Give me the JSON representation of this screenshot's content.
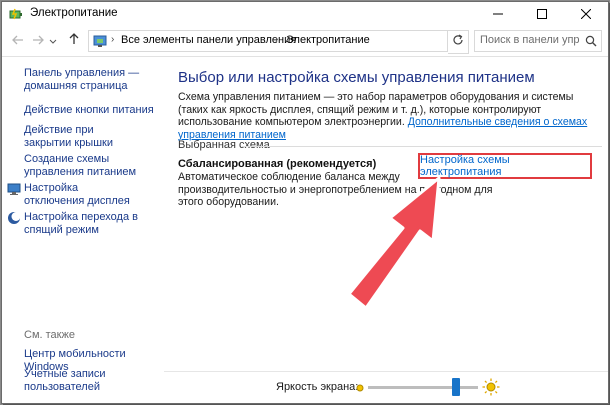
{
  "window": {
    "title": "Электропитание",
    "icons": {
      "app": "power-battery-icon",
      "minimize": "minimize-icon",
      "maximize": "maximize-icon",
      "close": "close-icon"
    }
  },
  "address_bar": {
    "crumbs": [
      "Все элементы панели управления",
      "Электропитание"
    ],
    "search_placeholder": "Поиск в панели управления",
    "icons": {
      "back": "arrow-left-icon",
      "forward": "arrow-right-icon",
      "recent": "chevron-down-icon",
      "up": "arrow-up-icon",
      "location": "control-panel-icon",
      "refresh": "refresh-icon",
      "search": "search-icon"
    }
  },
  "sidebar": {
    "home_link": "Панель управления — домашняя страница",
    "links": [
      {
        "label": "Действие кнопки питания"
      },
      {
        "label": "Действие при закрытии крышки"
      },
      {
        "label": "Создание схемы управления питанием"
      },
      {
        "label": "Настройка отключения дисплея",
        "icon": "display-icon"
      },
      {
        "label": "Настройка перехода в спящий режим",
        "icon": "moon-sleep-icon"
      }
    ],
    "see_also_label": "См. также",
    "see_also": [
      {
        "label": "Центр мобильности Windows"
      },
      {
        "label": "Учетные записи пользователей"
      }
    ]
  },
  "main": {
    "heading": "Выбор или настройка схемы управления питанием",
    "description": "Схема управления питанием — это набор параметров оборудования и системы (таких как яркость дисплея, спящий режим и т. д.), которые контролируют использование компьютером электроэнергии.",
    "description_link": "Дополнительные сведения о схемах управления питанием",
    "selected_plan_label": "Выбранная схема",
    "plan": {
      "name": "Сбалансированная (рекомендуется)",
      "description": "Автоматическое соблюдение баланса между производительностью и энергопотреблением на пригодном для этого оборудовании.",
      "settings_link": "Настройка схемы электропитания"
    }
  },
  "footer": {
    "brightness_label": "Яркость экрана:",
    "brightness_value": 0.8,
    "icons": {
      "dim": "sun-dim-icon",
      "bright": "sun-bright-icon"
    }
  },
  "colors": {
    "heading": "#1e3287",
    "link": "#0066cc",
    "sidebar_link": "#1a3a8a",
    "highlight_border": "#e13b3f",
    "arrow": "#ee4a53",
    "slider": "#1874c9"
  }
}
